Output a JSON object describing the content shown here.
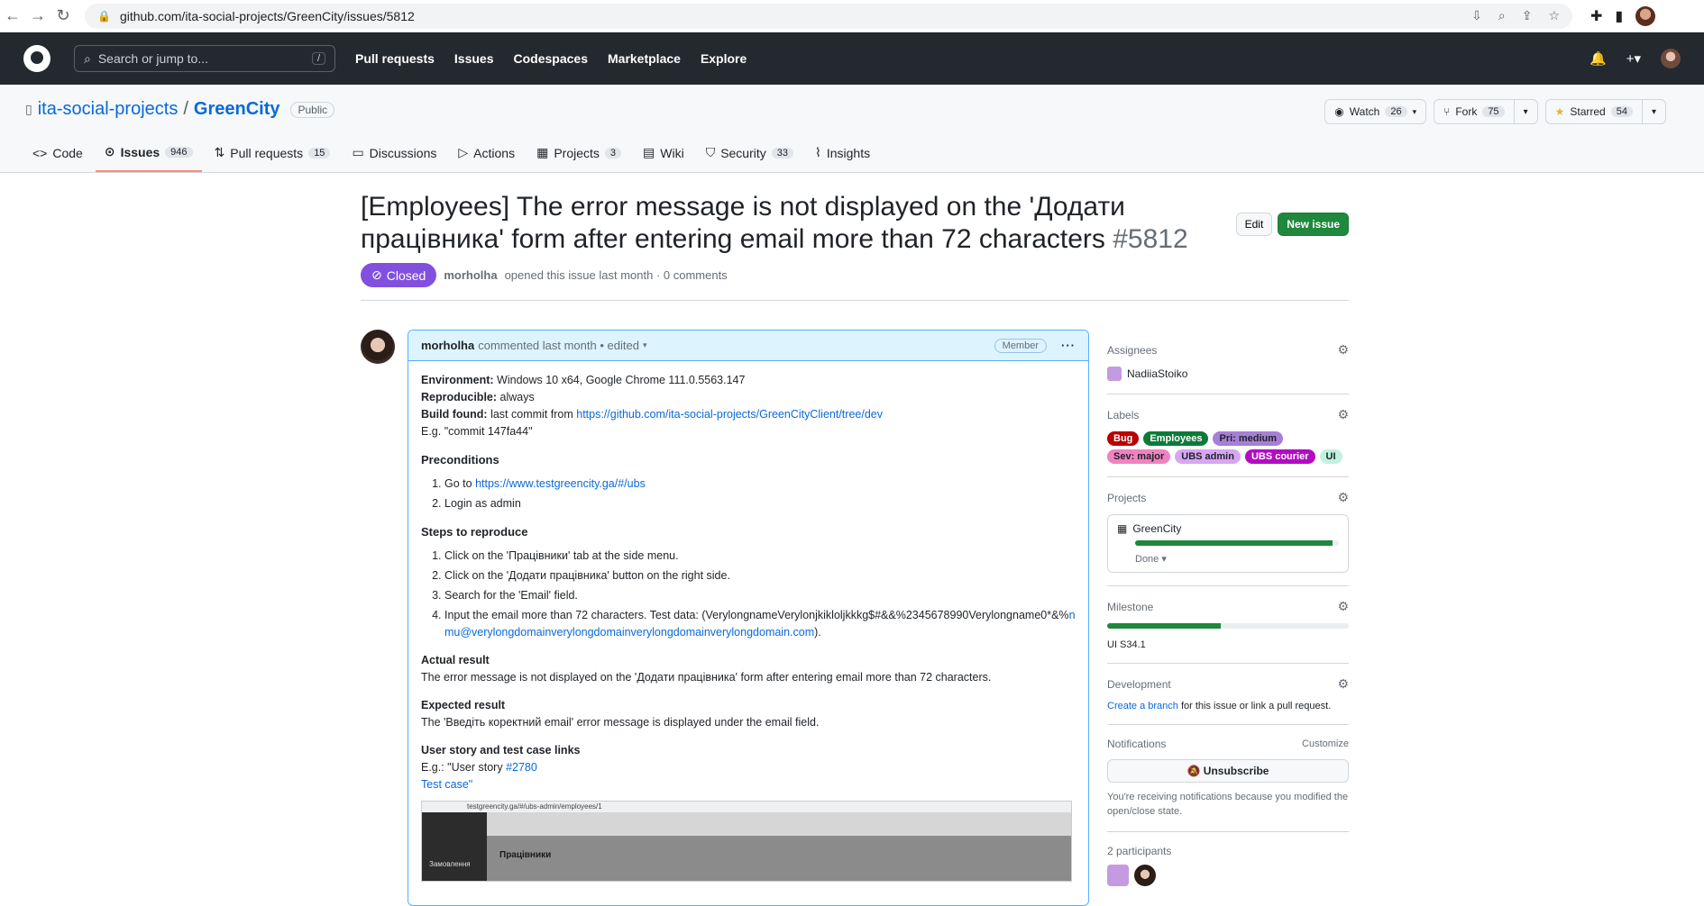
{
  "browser": {
    "url": "github.com/ita-social-projects/GreenCity/issues/5812"
  },
  "header": {
    "search_placeholder": "Search or jump to...",
    "search_shortcut": "/",
    "nav": [
      "Pull requests",
      "Issues",
      "Codespaces",
      "Marketplace",
      "Explore"
    ],
    "bell_glyph": "🔔",
    "plus_glyph": "+▾"
  },
  "repo": {
    "owner": "ita-social-projects",
    "separator": "/",
    "name": "GreenCity",
    "visibility": "Public",
    "watch": {
      "label": "Watch",
      "count": "26"
    },
    "fork": {
      "label": "Fork",
      "count": "75"
    },
    "star": {
      "label": "Starred",
      "count": "54"
    },
    "tabs": [
      {
        "label": "Code",
        "count": ""
      },
      {
        "label": "Issues",
        "count": "946"
      },
      {
        "label": "Pull requests",
        "count": "15"
      },
      {
        "label": "Discussions",
        "count": ""
      },
      {
        "label": "Actions",
        "count": ""
      },
      {
        "label": "Projects",
        "count": "3"
      },
      {
        "label": "Wiki",
        "count": ""
      },
      {
        "label": "Security",
        "count": "33"
      },
      {
        "label": "Insights",
        "count": ""
      }
    ]
  },
  "issue": {
    "title": "[Employees] The error message is not displayed on the 'Додати працівника' form after entering email more than 72 characters",
    "number": "#5812",
    "edit_label": "Edit",
    "new_issue_label": "New issue",
    "state": "Closed",
    "author": "morholha",
    "meta_text": "opened this issue last month · 0 comments"
  },
  "comment": {
    "author": "morholha",
    "meta": "commented last month • edited",
    "role": "Member",
    "env_label": "Environment:",
    "env_value": "Windows 10 x64, Google Chrome 111.0.5563.147",
    "repro_label": "Reproducible:",
    "repro_value": "always",
    "build_label": "Build found:",
    "build_text": "last commit from",
    "build_link": "https://github.com/ita-social-projects/GreenCityClient/tree/dev",
    "eg_commit": "E.g. \"commit 147fa44\"",
    "preconditions_title": "Preconditions",
    "pre_step1_text": "Go to",
    "pre_step1_link": "https://www.testgreencity.ga/#/ubs",
    "pre_step2": "Login as admin",
    "steps_title": "Steps to reproduce",
    "step1": "Click on the 'Працівники' tab at the side menu.",
    "step2": "Click on the 'Додати працівника' button on the right side.",
    "step3": "Search for the 'Email' field.",
    "step4_text": "Input the email more than 72 characters. Test data: (VerylongnameVerylonjkikloljkkkg$#&&%2345678990Verylongname0*&%",
    "step4_link": "nmu@verylongdomainverylongdomainverylongdomainverylongdomain.com",
    "step4_end": ").",
    "actual_title": "Actual result",
    "actual_text": "The error message is not displayed on the 'Додати працівника' form after entering email more than 72 characters.",
    "expected_title": "Expected result",
    "expected_text": "The 'Введіть коректний email' error message is displayed under the email field.",
    "story_title": "User story and test case links",
    "story_text": "E.g.: \"User story",
    "story_link": "#2780",
    "test_case": "Test case\"",
    "shot_url": "testgreencity.ga/#/ubs-admin/employees/1",
    "shot_title": "Працівники",
    "shot_side_item": "Замовлення"
  },
  "sidebar": {
    "assignees_title": "Assignees",
    "assignee": "NadiiaStoiko",
    "labels_title": "Labels",
    "labels": [
      {
        "name": "Bug",
        "bg": "#b60205",
        "fg": "#ffffff"
      },
      {
        "name": "Employees",
        "bg": "#0e7a3a",
        "fg": "#ffffff"
      },
      {
        "name": "Pri: medium",
        "bg": "#a77fd6",
        "fg": "#1f2328"
      },
      {
        "name": "Sev: major",
        "bg": "#f082c1",
        "fg": "#1f2328"
      },
      {
        "name": "UBS admin",
        "bg": "#d7a6f2",
        "fg": "#1f2328"
      },
      {
        "name": "UBS courier",
        "bg": "#b30bc2",
        "fg": "#ffffff"
      },
      {
        "name": "UI",
        "bg": "#bff2e0",
        "fg": "#1f2328"
      }
    ],
    "projects_title": "Projects",
    "project_name": "GreenCity",
    "project_progress": 0.97,
    "project_status": "Done ▾",
    "milestone_title": "Milestone",
    "milestone_progress": 0.47,
    "milestone_name": "UI S34.1",
    "development_title": "Development",
    "dev_link": "Create a branch",
    "dev_text": "for this issue or link a pull request.",
    "notifications_title": "Notifications",
    "customize": "Customize",
    "unsubscribe": "Unsubscribe",
    "notif_text": "You're receiving notifications because you modified the open/close state.",
    "participants_title": "2 participants"
  }
}
